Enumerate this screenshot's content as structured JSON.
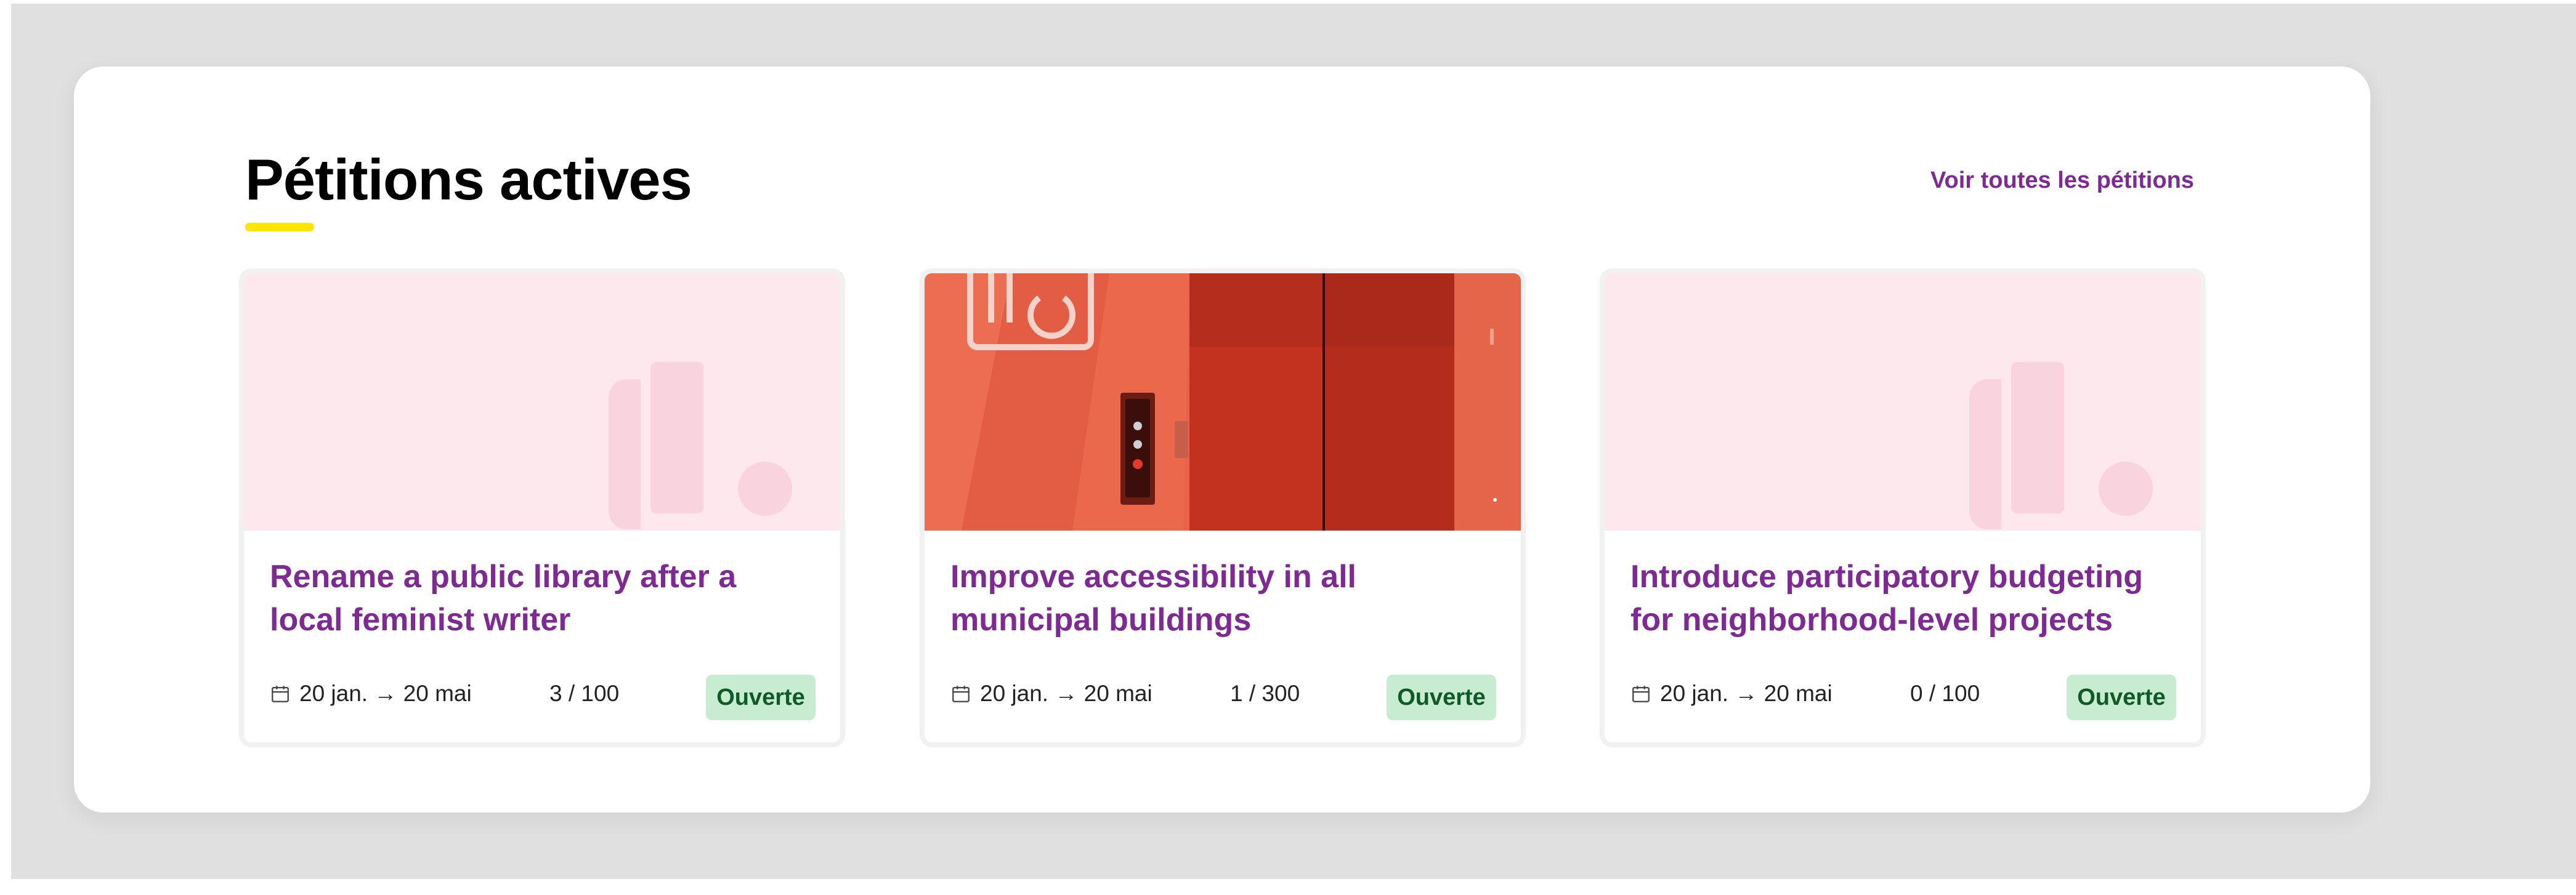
{
  "section": {
    "title": "Pétitions actives",
    "view_all_label": "Voir toutes les pétitions"
  },
  "colors": {
    "accent": "#7f2a94",
    "underline": "#ffe600",
    "badge_bg": "#c7ecd0",
    "badge_text": "#0f5a26",
    "placeholder_bg": "#fde8ee",
    "page_bg": "#e0e0e0"
  },
  "icons": {
    "calendar": "calendar-icon",
    "arrow": "arrow-right-icon",
    "placeholder_logo": "placeholder-logo-icon"
  },
  "petitions": [
    {
      "title": "Rename a public library after a local feminist writer",
      "date_range": "20 jan. → 20 mai",
      "count": "3 / 100",
      "status": "Ouverte",
      "image": "placeholder"
    },
    {
      "title": "Improve accessibility in all municipal buildings",
      "date_range": "20 jan. → 20 mai",
      "count": "1 / 300",
      "status": "Ouverte",
      "image": "elevator-photo"
    },
    {
      "title": "Introduce participatory budgeting for neighborhood-level projects",
      "date_range": "20 jan. → 20 mai",
      "count": "0 / 100",
      "status": "Ouverte",
      "image": "placeholder"
    }
  ]
}
